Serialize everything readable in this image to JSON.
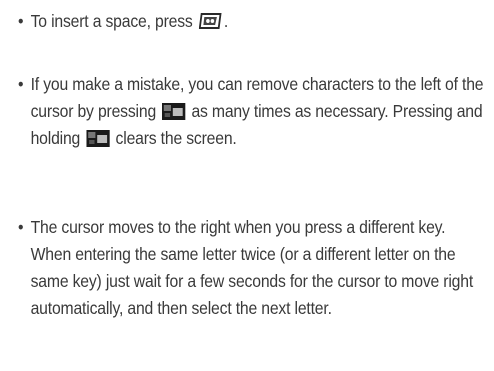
{
  "bullet_char": "•",
  "bullets": [
    {
      "before": "To insert a space, press",
      "key_icon": "space-key-icon",
      "after": "."
    },
    {
      "part1": "If you make a mistake, you can remove characters to the left of the cursor by pressing",
      "key_icon_1": "clear-key-icon",
      "part2": "as many times as necessary. Pressing and holding",
      "key_icon_2": "clear-key-icon",
      "part3": "clears the screen."
    },
    {
      "text": "The cursor moves to the right when you press a different key. When entering the same letter twice (or a different letter on the same key) just wait for a few seconds for the cursor to move right automatically, and then select the next letter."
    }
  ]
}
